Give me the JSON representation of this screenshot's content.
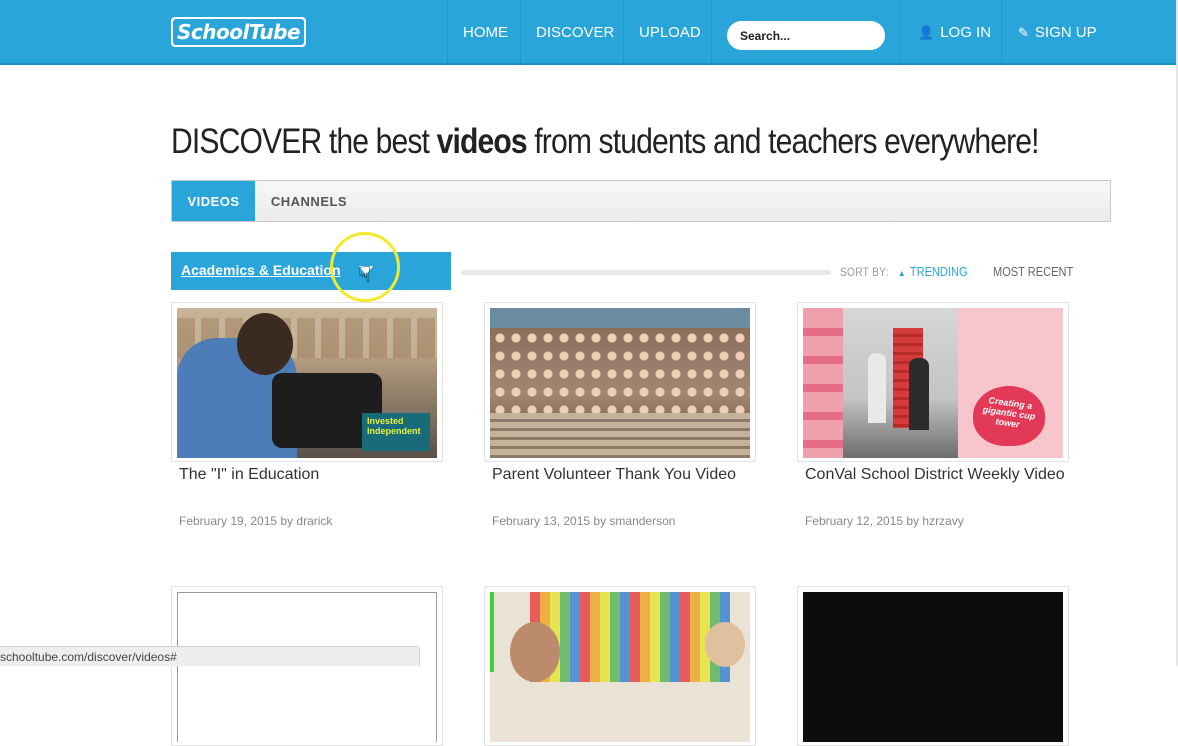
{
  "header": {
    "logo_text": "SchoolTube",
    "nav": {
      "home": "HOME",
      "discover": "DISCOVER",
      "upload": "UPLOAD",
      "login": "LOG IN",
      "signup": "SIGN UP"
    },
    "search": {
      "placeholder": "Search..."
    }
  },
  "heading": {
    "part1": "DISCOVER the best ",
    "bold": "videos",
    "part2": " from students and teachers everywhere!"
  },
  "tabs": [
    {
      "label": "VIDEOS"
    },
    {
      "label": "CHANNELS"
    }
  ],
  "category": {
    "label": "Academics & Education"
  },
  "sort": {
    "label": "SORT BY:",
    "trending": "TRENDING",
    "recent": "MOST RECENT"
  },
  "videos": [
    {
      "title": "The \"I\" in Education",
      "meta": "February 19, 2015 by drarick",
      "thumb_text": "Invested\nIndependent"
    },
    {
      "title": "Parent Volunteer Thank You Video",
      "meta": "February 13, 2015 by smanderson"
    },
    {
      "title": "ConVal School District Weekly Video",
      "meta": "February 12, 2015 by hzrzavy",
      "thumb_text": "Creating a gigantic cup tower"
    }
  ],
  "status_bar": {
    "url": "schooltube.com/discover/videos#"
  },
  "colors": {
    "brand": "#2aa5d9",
    "cursor_highlight": "#f1ea2c"
  }
}
